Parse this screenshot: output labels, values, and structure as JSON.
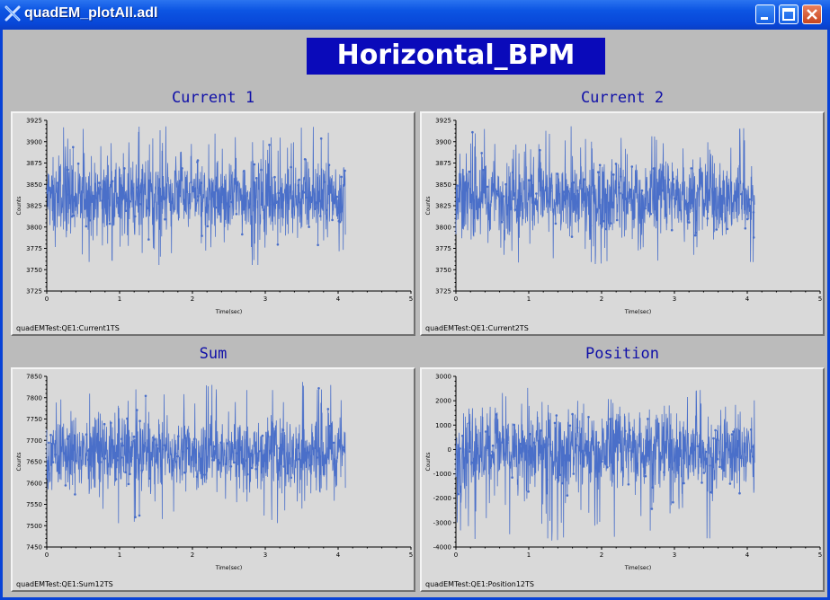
{
  "window": {
    "title": "quadEM_plotAll.adl"
  },
  "banner": {
    "text": "Horizontal_BPM",
    "bg": "#0a0aba"
  },
  "line_color": "#4a6fc9",
  "plots": [
    {
      "title": "Current 1",
      "ylabel": "Counts",
      "xlabel": "Time(sec)",
      "pv": "quadEMTest:QE1:Current1TS",
      "yticks": [
        "3925",
        "3900",
        "3875",
        "3850",
        "3825",
        "3800",
        "3775",
        "3750",
        "3725"
      ],
      "xticks": [
        "0",
        "1",
        "2",
        "3",
        "4",
        "5"
      ]
    },
    {
      "title": "Current 2",
      "ylabel": "Counts",
      "xlabel": "Time(sec)",
      "pv": "quadEMTest:QE1:Current2TS",
      "yticks": [
        "3925",
        "3900",
        "3875",
        "3850",
        "3825",
        "3800",
        "3775",
        "3750",
        "3725"
      ],
      "xticks": [
        "0",
        "1",
        "2",
        "3",
        "4",
        "5"
      ]
    },
    {
      "title": "Sum",
      "ylabel": "Counts",
      "xlabel": "Time(sec)",
      "pv": "quadEMTest:QE1:Sum12TS",
      "yticks": [
        "7850",
        "7800",
        "7750",
        "7700",
        "7650",
        "7600",
        "7550",
        "7500",
        "7450"
      ],
      "xticks": [
        "0",
        "1",
        "2",
        "3",
        "4",
        "5"
      ]
    },
    {
      "title": "Position",
      "ylabel": "Counts",
      "xlabel": "Time(sec)",
      "pv": "quadEMTest:QE1:Position12TS",
      "yticks": [
        "3000",
        "2000",
        "1000",
        "0",
        "-1000",
        "-2000",
        "-3000",
        "-4000"
      ],
      "xticks": [
        "0",
        "1",
        "2",
        "3",
        "4",
        "5"
      ]
    }
  ],
  "chart_data": [
    {
      "type": "line",
      "title": "Current 1",
      "xlabel": "Time(sec)",
      "ylabel": "Counts",
      "xlim": [
        0,
        5
      ],
      "ylim": [
        3725,
        3925
      ],
      "x_extent": [
        0,
        4.1
      ],
      "series": [
        {
          "mean": 3835,
          "spread": 35,
          "spike_range": [
            3755,
            3920
          ]
        }
      ]
    },
    {
      "type": "line",
      "title": "Current 2",
      "xlabel": "Time(sec)",
      "ylabel": "Counts",
      "xlim": [
        0,
        5
      ],
      "ylim": [
        3725,
        3925
      ],
      "x_extent": [
        0,
        4.1
      ],
      "series": [
        {
          "mean": 3835,
          "spread": 35,
          "spike_range": [
            3755,
            3920
          ]
        }
      ]
    },
    {
      "type": "line",
      "title": "Sum",
      "xlabel": "Time(sec)",
      "ylabel": "Counts",
      "xlim": [
        0,
        5
      ],
      "ylim": [
        7450,
        7850
      ],
      "x_extent": [
        0,
        4.1
      ],
      "series": [
        {
          "mean": 7670,
          "spread": 70,
          "spike_range": [
            7505,
            7840
          ]
        }
      ]
    },
    {
      "type": "line",
      "title": "Position",
      "xlabel": "Time(sec)",
      "ylabel": "Counts",
      "xlim": [
        0,
        5
      ],
      "ylim": [
        -4000,
        3000
      ],
      "x_extent": [
        0,
        4.1
      ],
      "series": [
        {
          "mean": 0,
          "spread": 1300,
          "spike_range": [
            -3800,
            2600
          ]
        }
      ]
    }
  ]
}
